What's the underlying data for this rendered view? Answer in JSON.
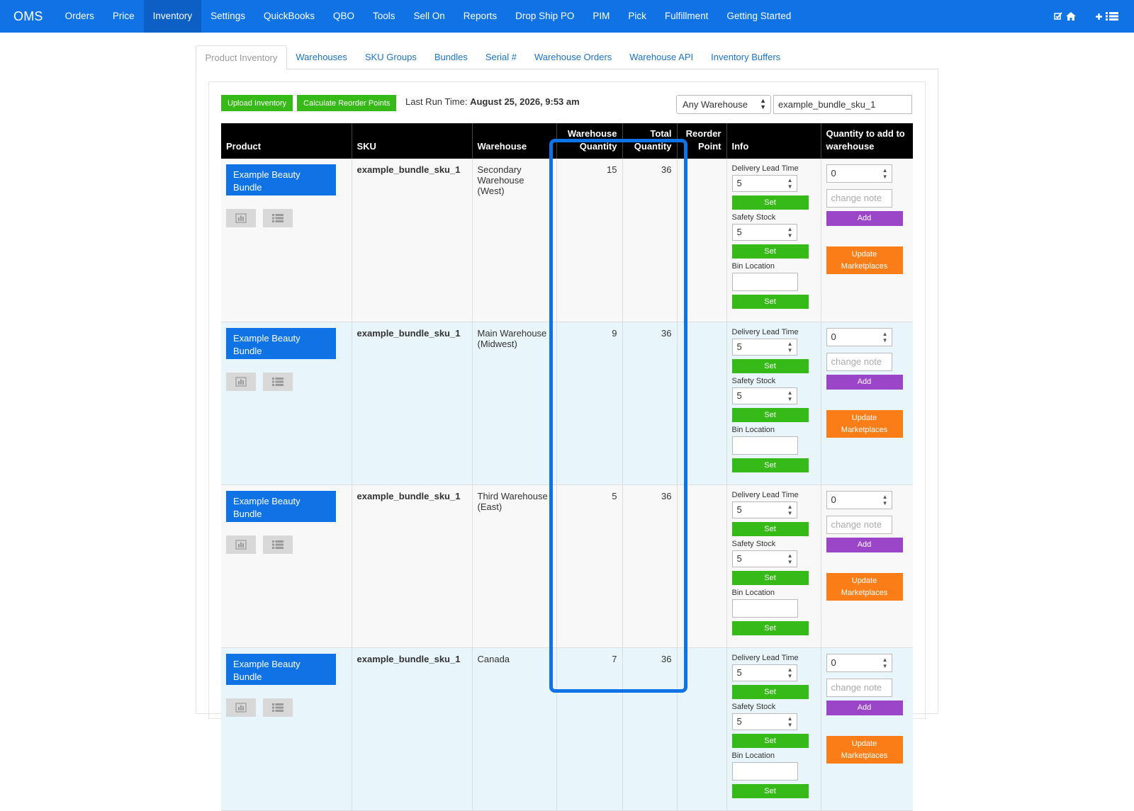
{
  "nav": {
    "brand": "OMS",
    "items": [
      "Orders",
      "Price",
      "Inventory",
      "Settings",
      "QuickBooks",
      "QBO",
      "Tools",
      "Sell On",
      "Reports",
      "Drop Ship PO",
      "PIM",
      "Pick",
      "Fulfillment",
      "Getting Started"
    ],
    "active": "Inventory",
    "right_icons": [
      "check-square-icon",
      "home-icon",
      "plus-icon",
      "list-icon"
    ]
  },
  "subtabs": {
    "items": [
      "Product Inventory",
      "Warehouses",
      "SKU Groups",
      "Bundles",
      "Serial #",
      "Warehouse Orders",
      "Warehouse API",
      "Inventory Buffers"
    ],
    "active": "Product Inventory"
  },
  "toolbar": {
    "upload_label": "Upload Inventory",
    "calc_label": "Calculate Reorder Points",
    "last_run_label": "Last Run Time:",
    "last_run_value": "August 25, 2026, 9:53 am",
    "warehouse_select": "Any Warehouse",
    "sku_search_value": "example_bundle_sku_1"
  },
  "table": {
    "headers": {
      "product": "Product",
      "sku": "SKU",
      "warehouse": "Warehouse",
      "wh_qty_1": "Warehouse",
      "wh_qty_2": "Quantity",
      "total_1": "Total",
      "total_2": "Quantity",
      "reorder_1": "Reorder",
      "reorder_2": "Point",
      "info": "Info",
      "qty_add_1": "Quantity to add to",
      "qty_add_2": "warehouse"
    },
    "labels": {
      "delivery": "Delivery Lead Time",
      "safety": "Safety Stock",
      "bin": "Bin Location",
      "set": "Set",
      "add": "Add",
      "change_note_placeholder": "change note",
      "update_1": "Update",
      "update_2": "Marketplaces"
    },
    "rows": [
      {
        "product": "Example Beauty Bundle",
        "sku": "example_bundle_sku_1",
        "warehouse": "Secondary Warehouse (West)",
        "warehouse_qty": "15",
        "total_qty": "36",
        "reorder": "",
        "delivery": "5",
        "safety": "5",
        "qty_add": "0"
      },
      {
        "product": "Example Beauty Bundle",
        "sku": "example_bundle_sku_1",
        "warehouse": "Main Warehouse (Midwest)",
        "warehouse_qty": "9",
        "total_qty": "36",
        "reorder": "",
        "delivery": "5",
        "safety": "5",
        "qty_add": "0"
      },
      {
        "product": "Example Beauty Bundle",
        "sku": "example_bundle_sku_1",
        "warehouse": "Third Warehouse (East)",
        "warehouse_qty": "5",
        "total_qty": "36",
        "reorder": "",
        "delivery": "5",
        "safety": "5",
        "qty_add": "0"
      },
      {
        "product": "Example Beauty Bundle",
        "sku": "example_bundle_sku_1",
        "warehouse": "Canada",
        "warehouse_qty": "7",
        "total_qty": "36",
        "reorder": "",
        "delivery": "5",
        "safety": "5",
        "qty_add": "0"
      }
    ]
  },
  "colors": {
    "nav_blue": "#0f73e6",
    "green": "#35ba18",
    "purple": "#9b45c9",
    "orange": "#fb7d18",
    "highlight": "#0f73e6"
  }
}
